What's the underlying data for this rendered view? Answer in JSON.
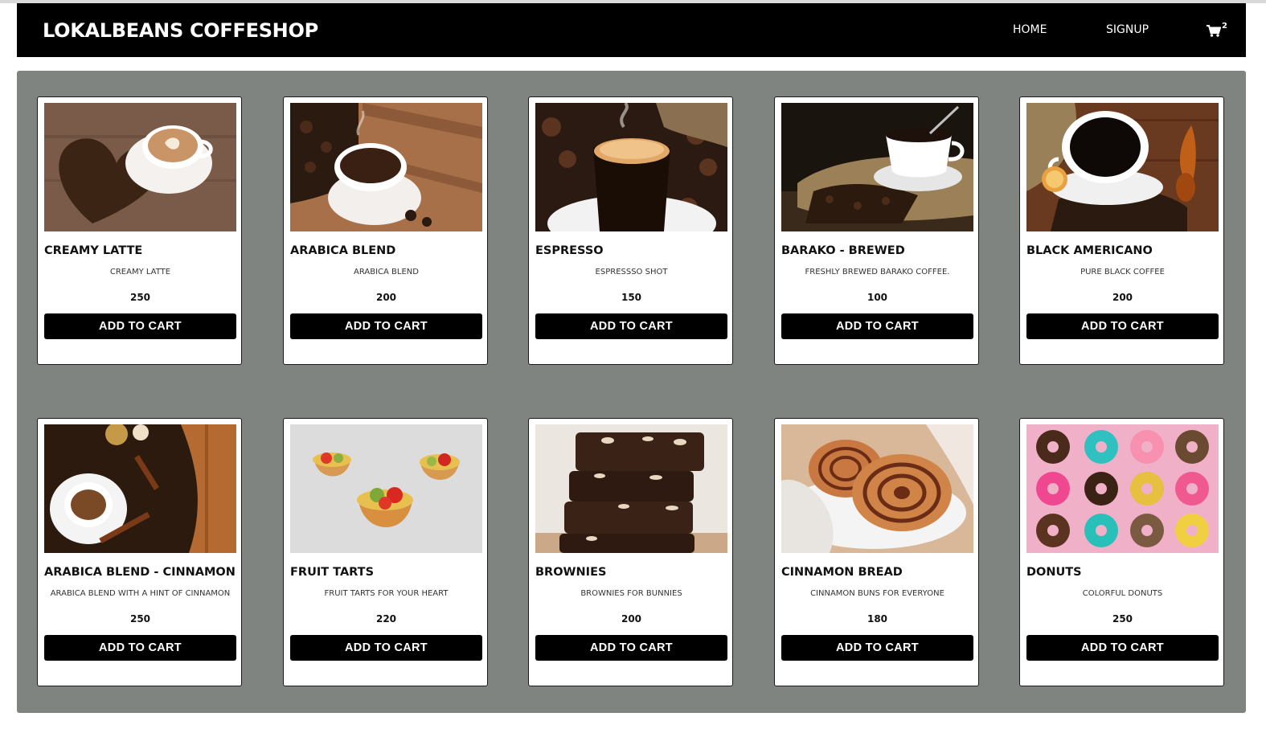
{
  "header": {
    "brand": "LOKALBEANS COFFESHOP",
    "nav": [
      {
        "label": "HOME"
      },
      {
        "label": "SIGNUP"
      }
    ],
    "cart_count": "2"
  },
  "colors": {
    "navbar_bg": "#000000",
    "content_bg": "#7f8480",
    "button_bg": "#000000",
    "button_text": "#ffffff"
  },
  "products": [
    {
      "name": "CREAMY LATTE",
      "description": "CREAMY LATTE",
      "price": "250",
      "button": "ADD TO CART",
      "image": "latte-heart-beans"
    },
    {
      "name": "ARABICA BLEND",
      "description": "ARABICA BLEND",
      "price": "200",
      "button": "ADD TO CART",
      "image": "coffee-cup-wooden-table"
    },
    {
      "name": "ESPRESSO",
      "description": "ESPRESSSO SHOT",
      "price": "150",
      "button": "ADD TO CART",
      "image": "espresso-glass"
    },
    {
      "name": "BARAKO - BREWED",
      "description": "FRESHLY BREWED BARAKO COFFEE.",
      "price": "100",
      "button": "ADD TO CART",
      "image": "white-cup-burlap"
    },
    {
      "name": "BLACK AMERICANO",
      "description": "PURE BLACK COFFEE",
      "price": "200",
      "button": "ADD TO CART",
      "image": "black-coffee-spoon"
    },
    {
      "name": "ARABICA BLEND - CINNAMON",
      "description": "ARABICA BLEND WITH A HINT OF CINNAMON",
      "price": "250",
      "button": "ADD TO CART",
      "image": "coffee-cinnamon-sticks"
    },
    {
      "name": "FRUIT TARTS",
      "description": "FRUIT TARTS FOR YOUR HEART",
      "price": "220",
      "button": "ADD TO CART",
      "image": "fruit-tarts"
    },
    {
      "name": "BROWNIES",
      "description": "BROWNIES FOR BUNNIES",
      "price": "200",
      "button": "ADD TO CART",
      "image": "brownie-stack"
    },
    {
      "name": "CINNAMON BREAD",
      "description": "CINNAMON BUNS FOR EVERYONE",
      "price": "180",
      "button": "ADD TO CART",
      "image": "cinnamon-buns"
    },
    {
      "name": "DONUTS",
      "description": "COLORFUL DONUTS",
      "price": "250",
      "button": "ADD TO CART",
      "image": "colorful-donuts"
    }
  ]
}
